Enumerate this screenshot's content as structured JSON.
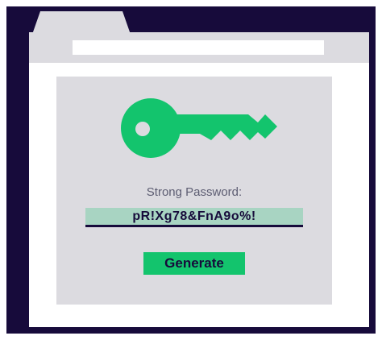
{
  "password_generator": {
    "label": "Strong Password:",
    "password": "pR!Xg78&FnA9o%!",
    "generate_label": "Generate"
  },
  "icons": {
    "key": "key-icon"
  },
  "colors": {
    "frame": "#170b3b",
    "panel": "#dcdbe0",
    "accent": "#13c46d",
    "password_highlight": "#a8d4c2"
  }
}
